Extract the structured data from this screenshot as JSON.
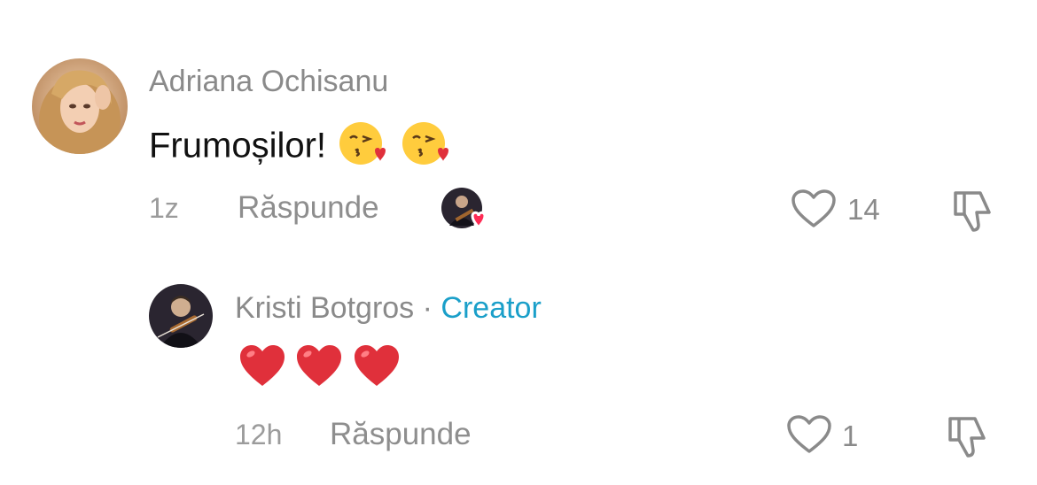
{
  "comments": [
    {
      "author": "Adriana Ochisanu",
      "text": "Frumoșilor!",
      "emoji": [
        "kissing-heart-emoji",
        "kissing-heart-emoji"
      ],
      "time": "1z",
      "reply_label": "Răspunde",
      "likes": "14",
      "liked_by_creator": true
    },
    {
      "author": "Kristi Botgros",
      "separator": " · ",
      "badge": "Creator",
      "emoji": [
        "red-heart-emoji",
        "red-heart-emoji",
        "red-heart-emoji"
      ],
      "time": "12h",
      "reply_label": "Răspunde",
      "likes": "1"
    }
  ],
  "colors": {
    "creator_badge": "#1a9fc9",
    "meta_gray": "#9b9b9b",
    "heart_red": "#e0303b"
  }
}
